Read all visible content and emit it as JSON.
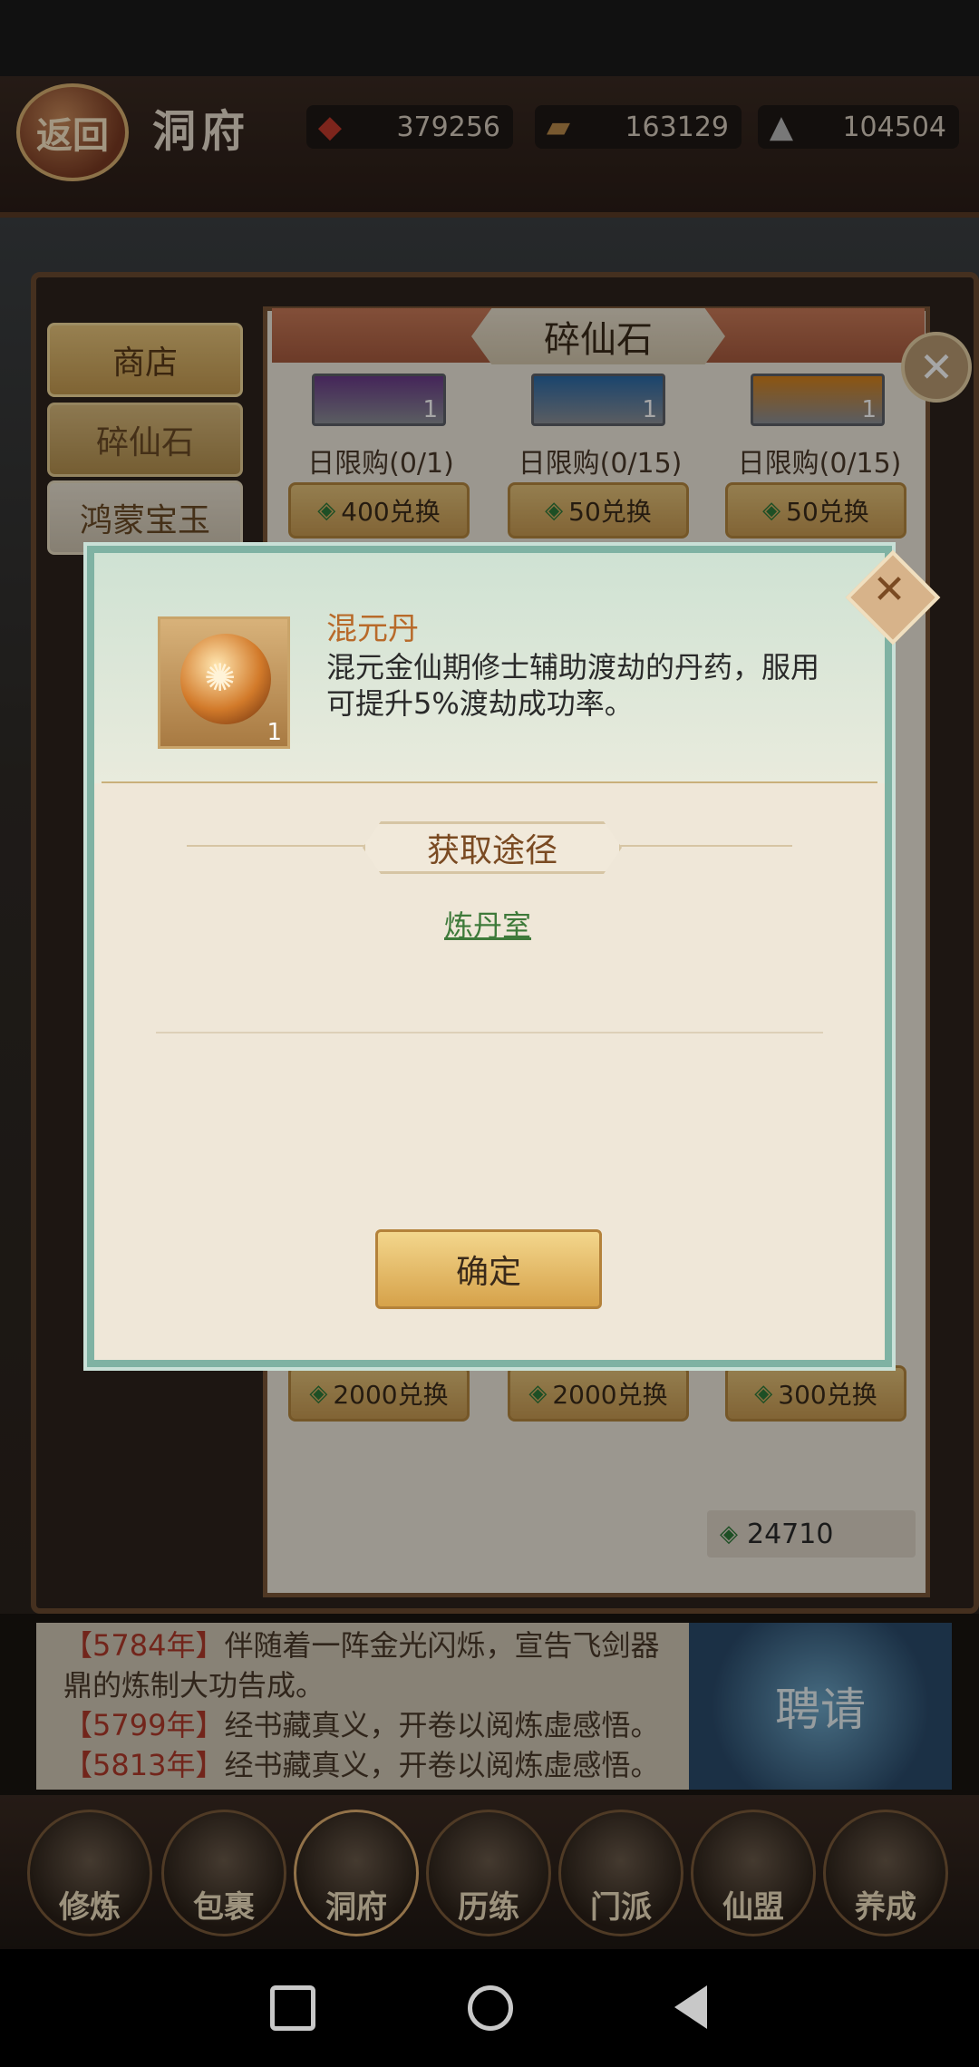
{
  "header": {
    "back_label": "返回",
    "title": "洞府",
    "resources": [
      {
        "icon": "meat-icon",
        "value": "379256"
      },
      {
        "icon": "wood-icon",
        "value": "163129"
      },
      {
        "icon": "ore-icon",
        "value": "104504"
      }
    ]
  },
  "sidebar": {
    "items": [
      {
        "label": "商店"
      },
      {
        "label": "碎仙石"
      },
      {
        "label": "鸿蒙宝玉"
      }
    ]
  },
  "shop": {
    "title": "碎仙石",
    "top_items": [
      {
        "qty": "1",
        "limit": "日限购(0/1)",
        "price": "400兑换"
      },
      {
        "qty": "1",
        "limit": "日限购(0/15)",
        "price": "50兑换"
      },
      {
        "qty": "1",
        "limit": "日限购(0/15)",
        "price": "50兑换"
      }
    ],
    "bottom_prices": [
      "2000兑换",
      "2000兑换",
      "300兑换"
    ],
    "balance": "24710"
  },
  "modal": {
    "item_name": "混元丹",
    "item_qty": "1",
    "item_desc": "混元金仙期修士辅助渡劫的丹药，服用可提升5%渡劫成功率。",
    "source_title": "获取途径",
    "source_link": "炼丹室",
    "confirm_label": "确定"
  },
  "log": {
    "lines": [
      {
        "year": "【5784年】",
        "text": "伴随着一阵金光闪烁，宣告飞剑器"
      },
      {
        "year": "",
        "text": "鼎的炼制大功告成。"
      },
      {
        "year": "【5799年】",
        "text": "经书藏真义，开卷以阅炼虚感悟。"
      },
      {
        "year": "【5813年】",
        "text": "经书藏真义，开卷以阅炼虚感悟。"
      }
    ],
    "invite_label": "聘请"
  },
  "nav": {
    "items": [
      {
        "label": "修炼"
      },
      {
        "label": "包裹"
      },
      {
        "label": "洞府"
      },
      {
        "label": "历练"
      },
      {
        "label": "门派"
      },
      {
        "label": "仙盟"
      },
      {
        "label": "养成"
      }
    ],
    "active_index": 2
  }
}
